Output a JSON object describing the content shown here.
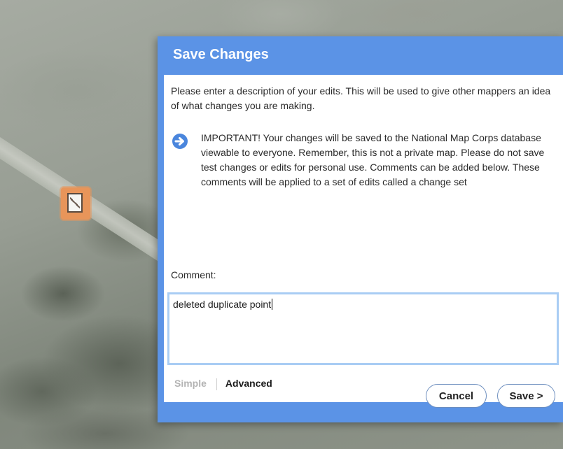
{
  "dialog": {
    "title": "Save Changes",
    "intro": "Please enter a description of your edits. This will be used to give other mappers an idea of what changes you are making.",
    "important": "IMPORTANT! Your changes will be saved to the National Map Corps database viewable to everyone. Remember, this is not a private map. Please do not save test changes or edits for personal use. Comments can be added below. These comments will be applied to a set of edits called a change set",
    "comment_label": "Comment:",
    "comment_value": "deleted duplicate point",
    "modes": {
      "simple": "Simple",
      "advanced": "Advanced",
      "active": "Advanced"
    },
    "buttons": {
      "cancel": "Cancel",
      "save": "Save >"
    }
  },
  "icons": {
    "info": "arrow-right-circle-icon",
    "map_feature": "building-poi-icon"
  },
  "colors": {
    "dialog_header": "#5b93e6",
    "comment_border": "#a9cdf4",
    "poi_highlight": "#e8955a"
  }
}
